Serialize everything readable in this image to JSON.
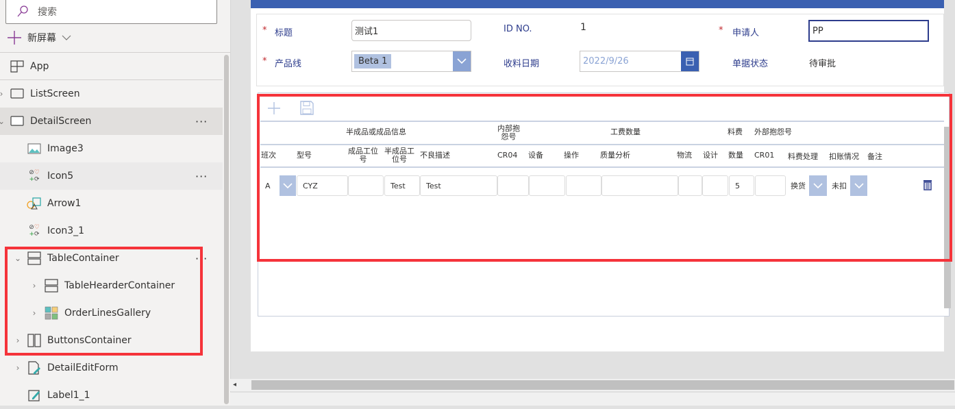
{
  "sidebar": {
    "search_placeholder": "搜索",
    "new_screen": "新屏幕",
    "items": [
      {
        "label": "App"
      },
      {
        "label": "ListScreen"
      },
      {
        "label": "DetailScreen"
      },
      {
        "label": "Image3"
      },
      {
        "label": "Icon5"
      },
      {
        "label": "Arrow1"
      },
      {
        "label": "Icon3_1"
      },
      {
        "label": "TableContainer"
      },
      {
        "label": "TableHearderContainer"
      },
      {
        "label": "OrderLinesGallery"
      },
      {
        "label": "ButtonsContainer"
      },
      {
        "label": "DetailEditForm"
      },
      {
        "label": "Label1_1"
      }
    ]
  },
  "form": {
    "title_label": "标题",
    "title_value": "测试1",
    "id_label": "ID NO.",
    "id_value": "1",
    "applicant_label": "申请人",
    "applicant_value": "PP",
    "product_line_label": "产品线",
    "product_line_value": "Beta 1",
    "receive_date_label": "收料日期",
    "receive_date_value": "2022/9/26",
    "status_label": "单据状态",
    "status_value": "待审批"
  },
  "table": {
    "group_headers": [
      "半成品或成品信息",
      "内部抱\n怨号",
      "工费数量",
      "料费",
      "外部抱怨号"
    ],
    "columns": [
      "班次",
      "型号",
      "成品工位\n号",
      "半成品工\n位号",
      "不良描述",
      "CR04",
      "设备",
      "操作",
      "质量分析",
      "物流",
      "设计",
      "数量",
      "CR01",
      "料费处理",
      "扣账情况",
      "备注"
    ],
    "row": {
      "shift": "A",
      "model": "CYZ",
      "station": "",
      "semi_station": "Test",
      "defect": "Test",
      "cr04": "",
      "equipment": "",
      "operation": "",
      "quality": "",
      "logistics": "",
      "design": "",
      "quantity": "5",
      "cr01": "",
      "fee_handling": "换货",
      "deduction": "未扣",
      "remark": ""
    }
  },
  "colors": {
    "accent": "#3a60b1",
    "highlight": "#f5333a",
    "dropdown": "#b0c1e0"
  }
}
